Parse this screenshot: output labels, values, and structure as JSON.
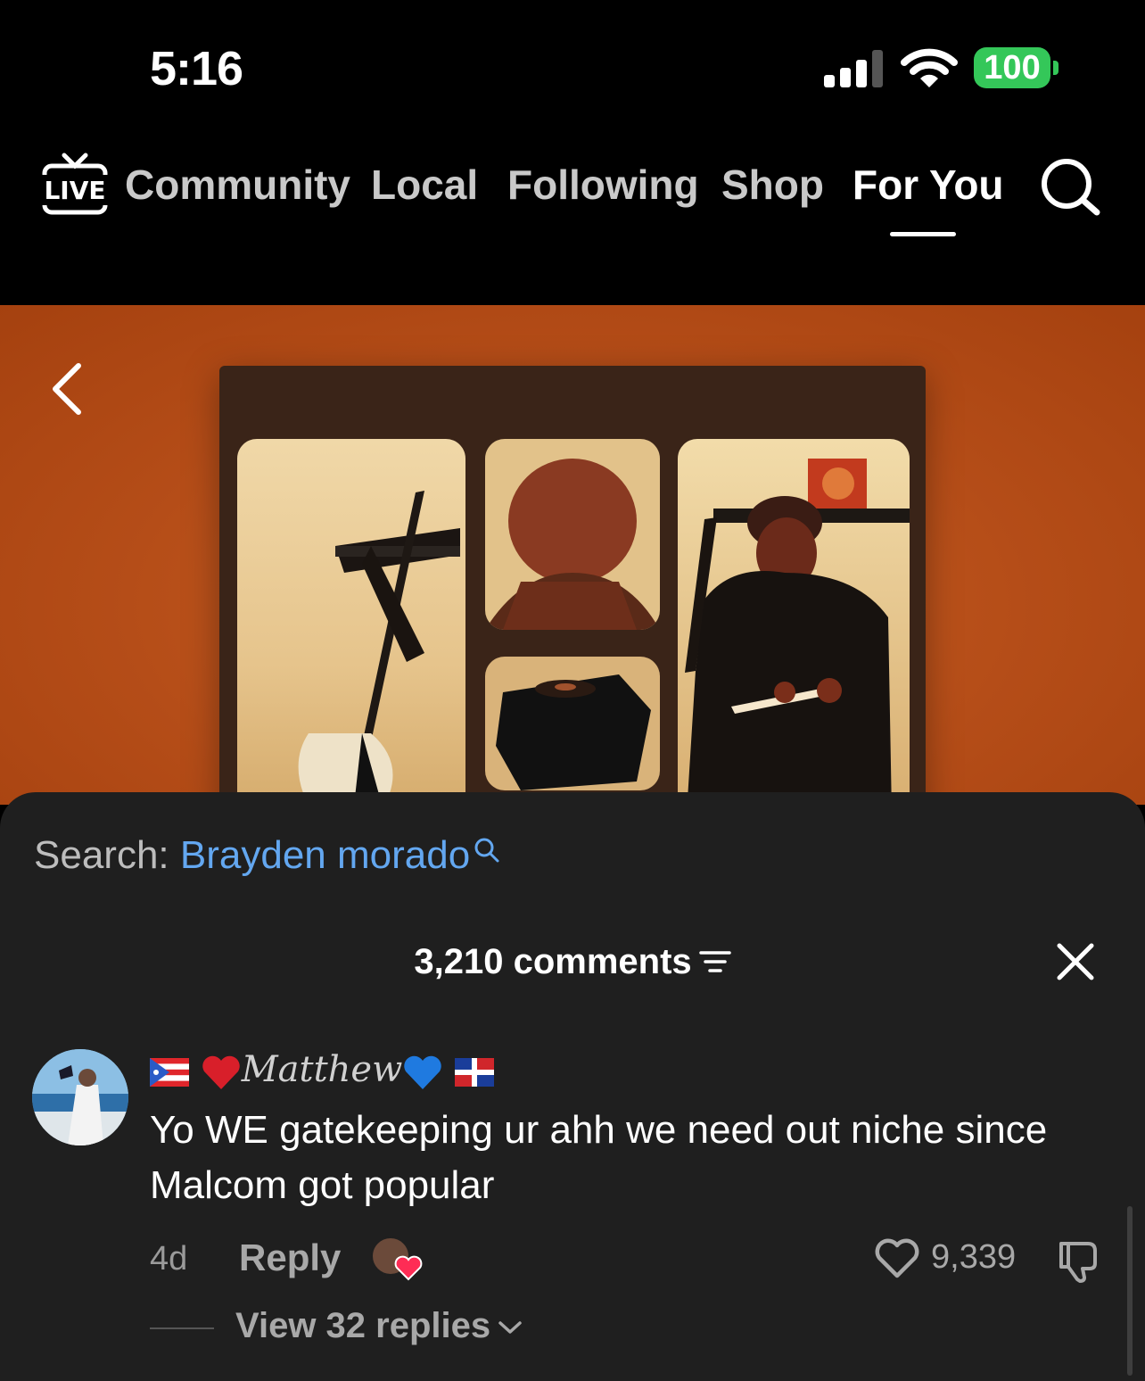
{
  "status_bar": {
    "time": "5:16",
    "battery": "100"
  },
  "top_nav": {
    "live_label": "LIVE",
    "tabs": [
      {
        "label": "Community"
      },
      {
        "label": "Local"
      },
      {
        "label": "Following"
      },
      {
        "label": "Shop"
      },
      {
        "label": "For You"
      }
    ],
    "active_tab": "For You"
  },
  "comments_sheet": {
    "search_prefix": "Search:",
    "search_term": "Brayden morado",
    "count_label": "3,210 comments",
    "comment": {
      "username": "Matthew",
      "text": "Yo WE gatekeeping ur ahh we need out niche since Malcom got popular",
      "age": "4d",
      "reply_label": "Reply",
      "like_count": "9,339",
      "view_replies_label": "View 32 replies"
    }
  },
  "colors": {
    "accent_blue": "#63a7f0",
    "battery_green": "#34c759",
    "sheet_bg": "#1f1f1f",
    "video_orange": "#ba521a"
  }
}
